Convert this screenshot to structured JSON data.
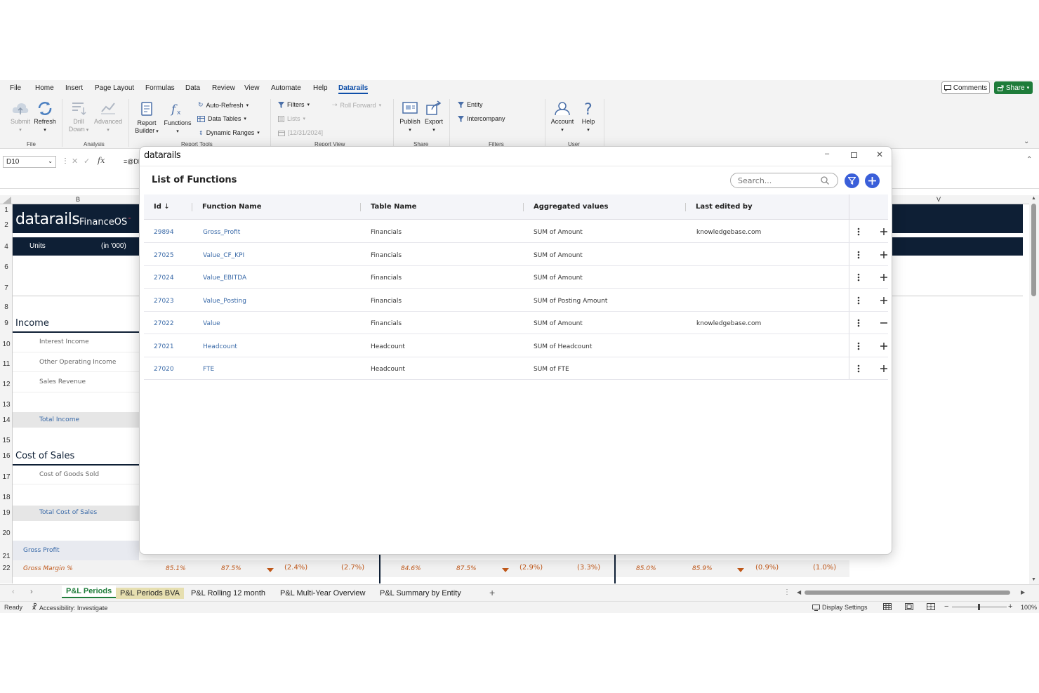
{
  "menu": [
    "File",
    "Home",
    "Insert",
    "Page Layout",
    "Formulas",
    "Data",
    "Review",
    "View",
    "Automate",
    "Help",
    "Datarails"
  ],
  "top_right": {
    "comments": "Comments",
    "share": "Share"
  },
  "ribbon": {
    "submit": "Submit",
    "refresh": "Refresh",
    "drill": "Drill",
    "down": "Down",
    "advanced": "Advanced",
    "report": "Report",
    "builder": "Builder",
    "functions": "Functions",
    "auto_refresh": "Auto-Refresh",
    "data_tables": "Data Tables",
    "dynamic_ranges": "Dynamic Ranges",
    "filters": "Filters",
    "lists": "Lists",
    "date": "[12/31/2024]",
    "roll_forward": "Roll Forward",
    "publish": "Publish",
    "export": "Export",
    "entity": "Entity",
    "intercompany": "Intercompany",
    "account": "Account",
    "help": "Help",
    "groups": {
      "file": "File",
      "analysis": "Analysis",
      "report_tools": "Report Tools",
      "report_view": "Report View",
      "share": "Share",
      "filters": "Filters",
      "user": "User"
    }
  },
  "formula": {
    "namebox": "D10",
    "fx": "fx",
    "content": "=@DF"
  },
  "columns": {
    "b": "B",
    "v": "V"
  },
  "rows": [
    "1",
    "2",
    "4",
    "6",
    "7",
    "8",
    "9",
    "10",
    "11",
    "12",
    "13",
    "14",
    "15",
    "16",
    "17",
    "18",
    "19",
    "20",
    "21",
    "22"
  ],
  "sheet": {
    "brand": "datarails",
    "brand_suffix": "FinanceOS",
    "tm": "™",
    "units_label": "Units",
    "units_value": "(in '000)",
    "income": "Income",
    "interest_income": "Interest Income",
    "other_operating_income": "Other Operating Income",
    "sales_revenue": "Sales Revenue",
    "total_income": "Total Income",
    "cost_of_sales": "Cost of Sales",
    "cogs": "Cost of Goods Sold",
    "total_cost_of_sales": "Total Cost of Sales",
    "gross_profit": "Gross Profit",
    "gross_margin": "Gross Margin %",
    "margin_values": [
      "85.1%",
      "87.5%",
      "(2.4%)",
      "(2.7%)",
      "84.6%",
      "87.5%",
      "(2.9%)",
      "(3.3%)",
      "85.0%",
      "85.9%",
      "(0.9%)",
      "(1.0%)"
    ]
  },
  "sheet_tabs": [
    "P&L Periods",
    "P&L Periods BVA",
    "P&L Rolling 12 month",
    "P&L Multi-Year Overview",
    "P&L Summary by Entity"
  ],
  "status": {
    "ready": "Ready",
    "accessibility": "Accessibility: Investigate",
    "display_settings": "Display Settings",
    "zoom": "100%"
  },
  "dialog": {
    "logo": "datarails",
    "title": "List of Functions",
    "search_placeholder": "Search...",
    "headers": {
      "id": "Id",
      "function_name": "Function Name",
      "table_name": "Table Name",
      "aggregated": "Aggregated values",
      "last_edited": "Last edited by"
    },
    "rows": [
      {
        "id": "29894",
        "name": "Gross_Profit",
        "table": "Financials",
        "agg": "SUM of Amount",
        "editor": "knowledgebase.com",
        "action": "+"
      },
      {
        "id": "27025",
        "name": "Value_CF_KPI",
        "table": "Financials",
        "agg": "SUM of Amount",
        "editor": "",
        "action": "+"
      },
      {
        "id": "27024",
        "name": "Value_EBITDA",
        "table": "Financials",
        "agg": "SUM of Amount",
        "editor": "",
        "action": "+"
      },
      {
        "id": "27023",
        "name": "Value_Posting",
        "table": "Financials",
        "agg": "SUM of Posting Amount",
        "editor": "",
        "action": "+"
      },
      {
        "id": "27022",
        "name": "Value",
        "table": "Financials",
        "agg": "SUM of Amount",
        "editor": "knowledgebase.com",
        "action": "−"
      },
      {
        "id": "27021",
        "name": "Headcount",
        "table": "Headcount",
        "agg": "SUM of Headcount",
        "editor": "",
        "action": "+"
      },
      {
        "id": "27020",
        "name": "FTE",
        "table": "Headcount",
        "agg": "SUM of FTE",
        "editor": "",
        "action": "+"
      }
    ]
  },
  "colors": {
    "navy": "#0e1f35",
    "accent": "#3a5fd9",
    "excel_green": "#1e7c3a",
    "link": "#3a6aa8",
    "orange": "#c0581a"
  }
}
